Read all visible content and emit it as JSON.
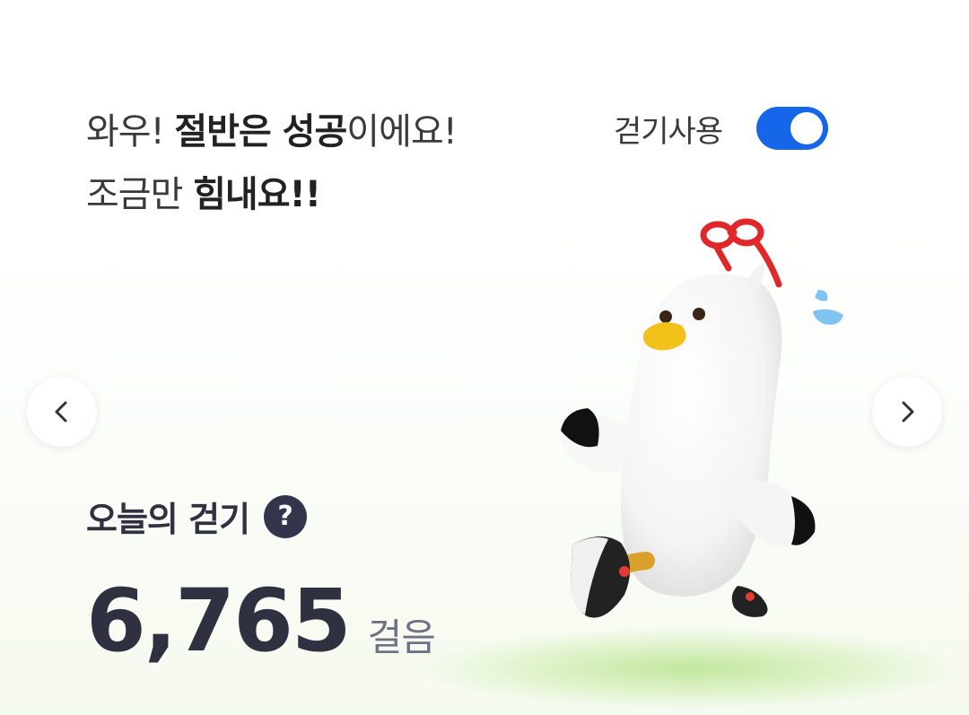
{
  "headline": {
    "line1_a": "와우! ",
    "line1_b": "절반은 성공",
    "line1_c": "이에요!",
    "line2_a": "조금만 ",
    "line2_b": "힘내요!!"
  },
  "walking_toggle": {
    "label": "걷기사용",
    "on": true,
    "color": "#1566e8"
  },
  "nav": {
    "prev_icon": "chevron-left-icon",
    "next_icon": "chevron-right-icon"
  },
  "today": {
    "label": "오늘의 걷기",
    "help_icon": "?",
    "steps": "6,765",
    "unit": "걸음"
  },
  "mascot": {
    "icon": "running-bird-mascot"
  },
  "colors": {
    "accent": "#1566e8",
    "text_dark": "#2f3140",
    "ground": "#9fdc6a"
  }
}
